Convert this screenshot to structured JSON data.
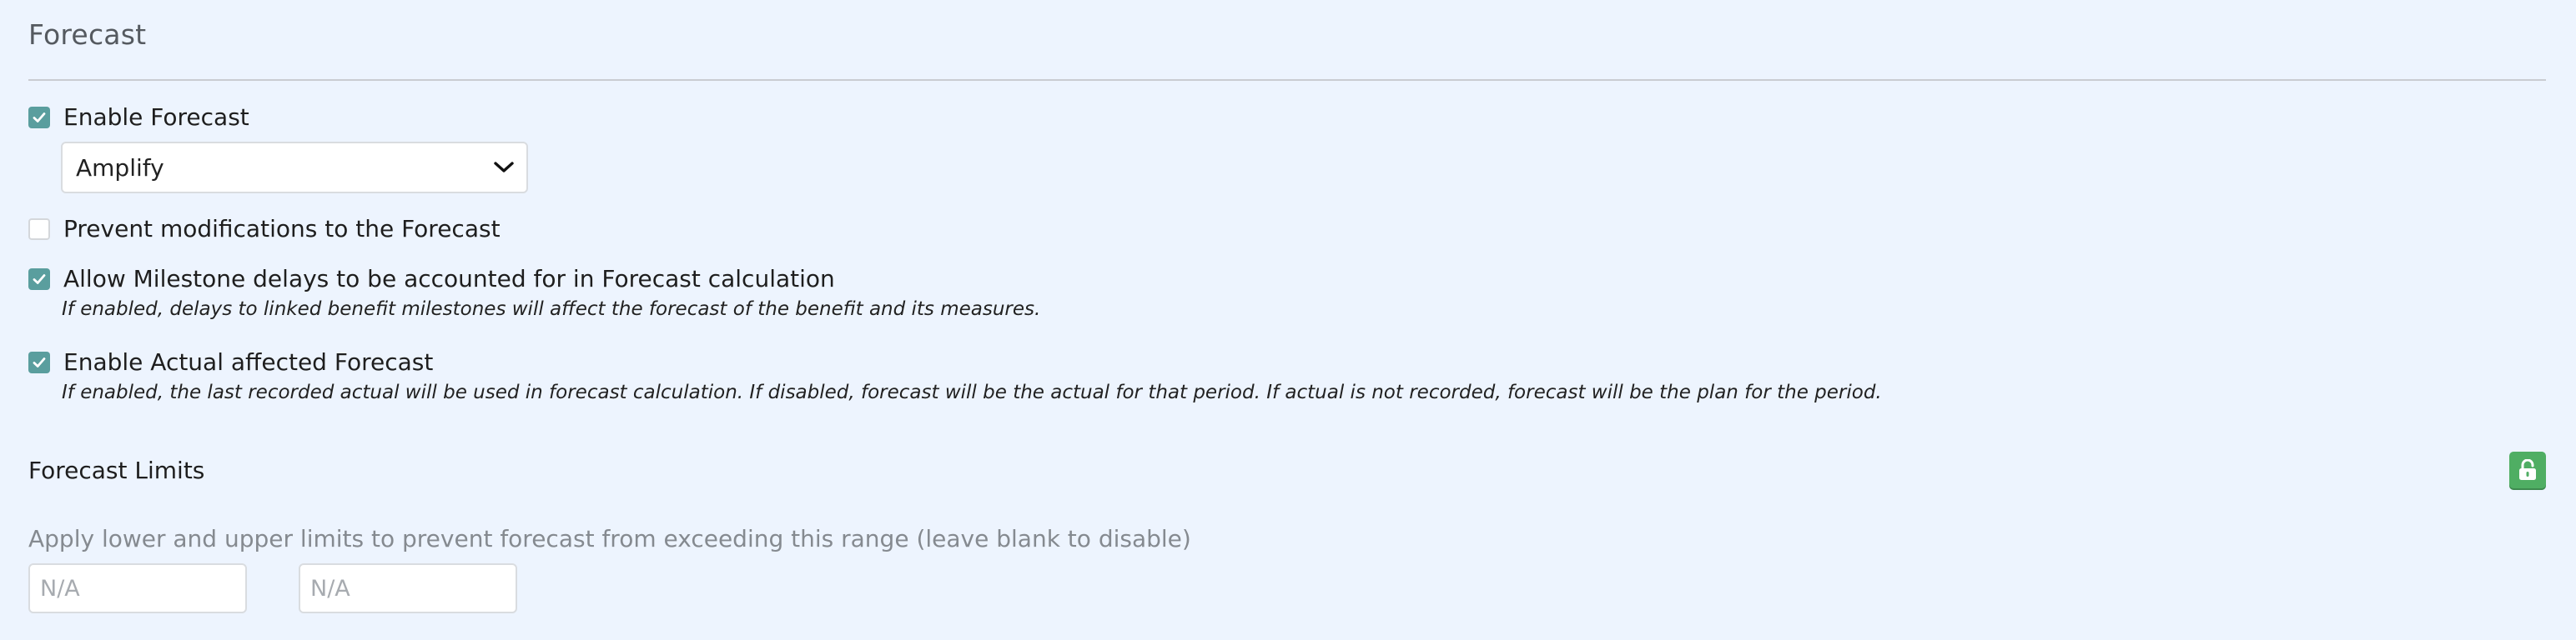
{
  "forecast": {
    "title": "Forecast",
    "enable_forecast": {
      "label": "Enable Forecast",
      "checked": true
    },
    "forecast_method": {
      "selected": "Amplify"
    },
    "prevent_modifications": {
      "label": "Prevent modifications to the Forecast",
      "checked": false
    },
    "milestone_delays": {
      "label": "Allow Milestone delays to be accounted for in Forecast calculation",
      "help": "If enabled, delays to linked benefit milestones will affect the forecast of the benefit and its measures.",
      "checked": true
    },
    "actual_affected": {
      "label": "Enable Actual affected Forecast",
      "help": "If enabled, the last recorded actual will be used in forecast calculation. If disabled, forecast will be the actual for that period. If actual is not recorded, forecast will be the plan for the period.",
      "checked": true
    }
  },
  "limits": {
    "title": "Forecast Limits",
    "description": "Apply lower and upper limits to prevent forecast from exceeding this range (leave blank to disable)",
    "lower_placeholder": "N/A",
    "upper_placeholder": "N/A",
    "lock_icon": "unlock-icon",
    "lock_color": "#4fae63"
  },
  "colors": {
    "background": "#edf4fe",
    "checkbox_checked": "#5a9e9e"
  }
}
